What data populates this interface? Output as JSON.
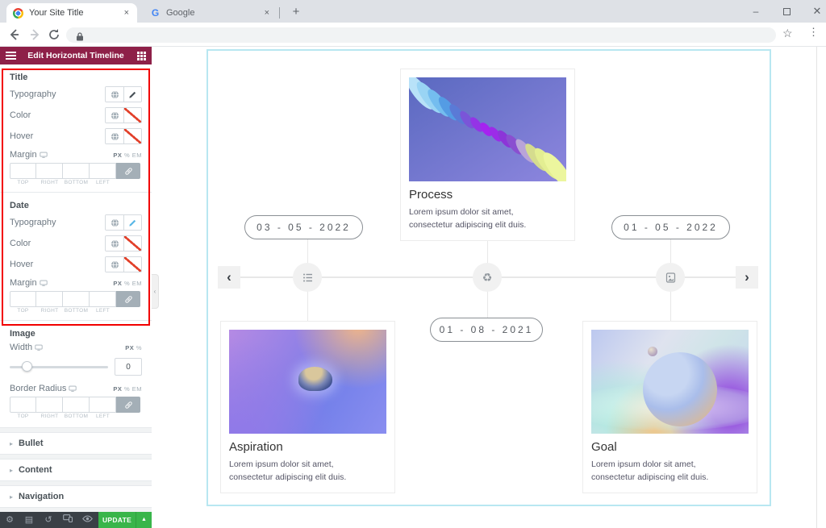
{
  "browser": {
    "tabs": [
      {
        "title": "Your Site Title"
      },
      {
        "title": "Google"
      }
    ],
    "new_tab": "+",
    "tab_close": "×",
    "minimize": "–",
    "close": "✕",
    "star": "☆",
    "kebab": "⋮"
  },
  "panel": {
    "header_title": "Edit Horizontal Timeline",
    "box_labels": [
      "TOP",
      "RIGHT",
      "BOTTOM",
      "LEFT"
    ],
    "units": {
      "px": "PX",
      "pct": "%",
      "em": "EM"
    },
    "groups": [
      {
        "label": "Title",
        "rows": [
          "Typography",
          "Color",
          "Hover"
        ],
        "margin": "Margin"
      },
      {
        "label": "Date",
        "rows": [
          "Typography",
          "Color",
          "Hover"
        ],
        "margin": "Margin"
      }
    ],
    "image": {
      "label": "Image",
      "width": "Width",
      "width_value": "0",
      "radius": "Border Radius"
    },
    "accordions": [
      "Bullet",
      "Content",
      "Navigation"
    ],
    "accordion_caret": "▸",
    "footer": {
      "update": "UPDATE",
      "caret": "▲",
      "icons": [
        "settings",
        "navigator",
        "history",
        "responsive",
        "preview"
      ],
      "glyph_settings": "⚙",
      "glyph_navigator": "▤",
      "glyph_history": "↺"
    }
  },
  "canvas": {
    "cards": [
      {
        "title": "Process",
        "desc": "Lorem ipsum dolor sit amet, consectetur adipiscing elit duis."
      },
      {
        "title": "Aspiration",
        "desc": "Lorem ipsum dolor sit amet, consectetur adipiscing elit duis."
      },
      {
        "title": "Goal",
        "desc": "Lorem ipsum dolor sit amet, consectetur adipiscing elit duis."
      }
    ],
    "dates": [
      "03 - 05 - 2022",
      "01 - 05 - 2022",
      "01 - 08 - 2021"
    ],
    "nav": {
      "prev": "‹",
      "next": "›"
    },
    "bullet_icons": [
      "list",
      "recycle",
      "document"
    ],
    "recycle_glyph": "♻"
  },
  "colors": {
    "accent": "#8e2048",
    "update_green": "#39b54a",
    "annotation_red": "#f20000",
    "section_outline": "#b8e7f1"
  }
}
